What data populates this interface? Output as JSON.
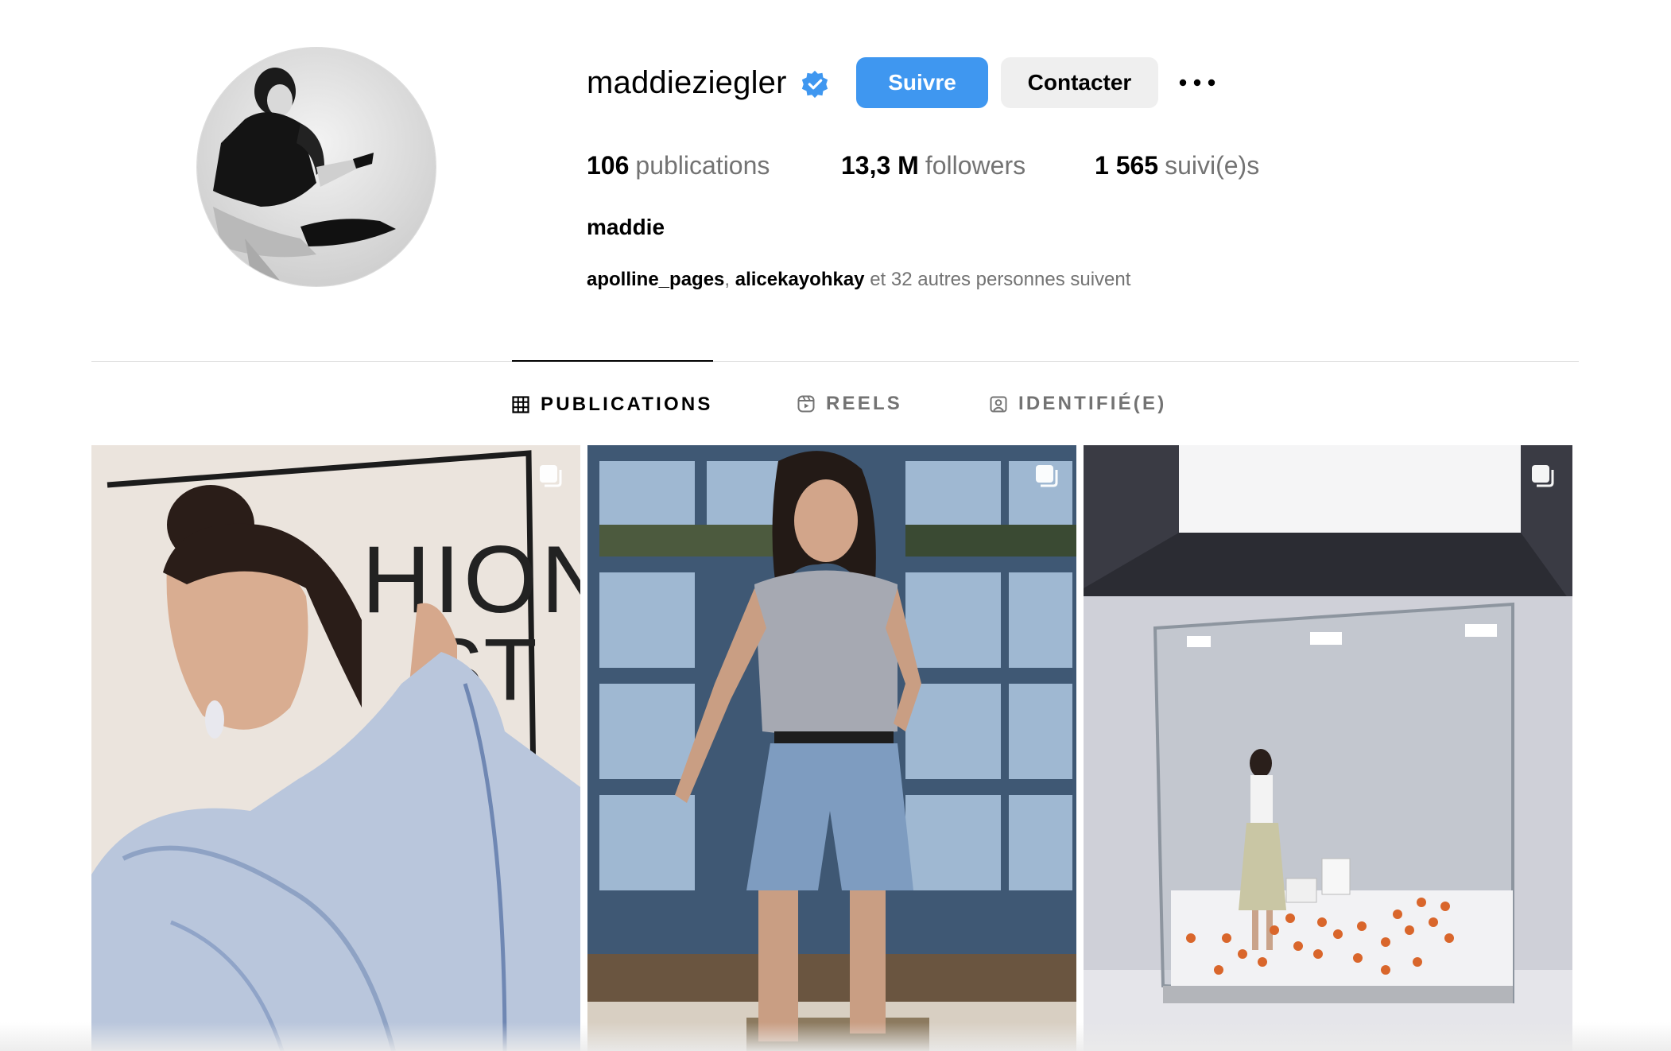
{
  "profile": {
    "username": "maddieziegler",
    "verified": true,
    "full_name": "maddie",
    "avatar_icon": "profile-photo"
  },
  "actions": {
    "follow_label": "Suivre",
    "contact_label": "Contacter",
    "more_icon": "more-options-icon"
  },
  "stats": {
    "posts": {
      "value": "106",
      "label": "publications"
    },
    "followers": {
      "value": "13,3 M",
      "label": "followers"
    },
    "following": {
      "value": "1 565",
      "label": "suivi(e)s"
    }
  },
  "followed_by": {
    "accounts": [
      "apolline_pages",
      "alicekayohkay"
    ],
    "separator": ",",
    "suffix": "et 32 autres personnes suivent"
  },
  "tabs": [
    {
      "label": "PUBLICATIONS",
      "icon": "grid-icon",
      "active": true
    },
    {
      "label": "REELS",
      "icon": "reels-icon",
      "active": false
    },
    {
      "label": "IDENTIFIÉ(E)",
      "icon": "tagged-icon",
      "active": false
    }
  ],
  "posts": [
    {
      "type": "carousel",
      "icon": "carousel-icon"
    },
    {
      "type": "carousel",
      "icon": "carousel-icon"
    },
    {
      "type": "carousel",
      "icon": "carousel-icon"
    }
  ],
  "colors": {
    "primary_button": "#3f97f0",
    "secondary_button": "#efefef",
    "verified_badge": "#3f97f0",
    "muted_text": "#737373",
    "divider": "#dbdbdb"
  }
}
